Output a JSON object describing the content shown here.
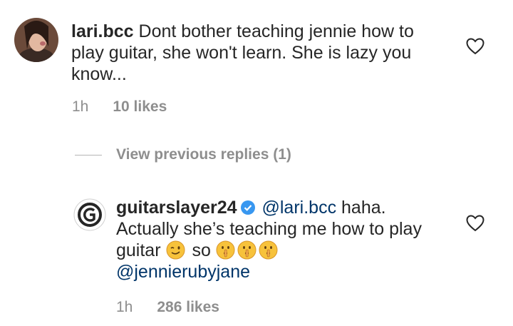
{
  "comment1": {
    "username": "lari.bcc",
    "text": "Dont bother teaching jennie how to play guitar, she won't learn. She is lazy you know...",
    "time": "1h",
    "likes": "10 likes"
  },
  "view_previous": "View previous replies (1)",
  "reply": {
    "username": "guitarslayer24",
    "mention1": "@lari.bcc",
    "text_a": "haha. Actually she’s teaching me how to play guitar",
    "text_b": "so",
    "mention2": "@jennierubyjane",
    "time": "1h",
    "likes": "286 likes"
  },
  "colors": {
    "text": "#262626",
    "muted": "#8e8e8e",
    "mention": "#003569",
    "verified": "#3897f0"
  },
  "icons": [
    "heart-icon",
    "verified-icon",
    "winking-face-emoji",
    "shushing-face-emoji"
  ]
}
